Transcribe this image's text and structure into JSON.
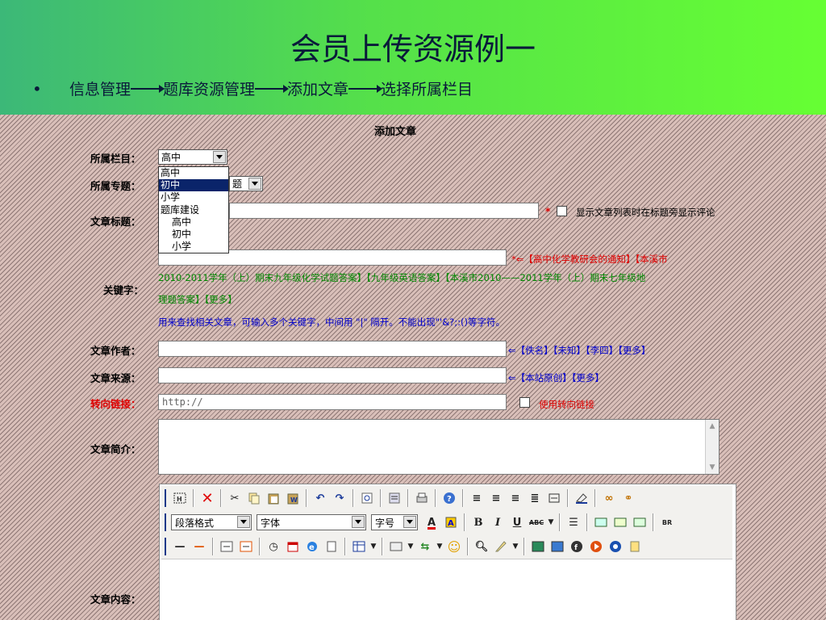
{
  "slide": {
    "title": "会员上传资源例一",
    "bullet": "•",
    "breadcrumb": [
      "信息管理",
      "题库资源管理",
      "添加文章",
      "选择所属栏目"
    ]
  },
  "form": {
    "title": "添加文章",
    "labels": {
      "column": "所属栏目：",
      "topic": "所属专题：",
      "article_title": "文章标题：",
      "keywords": "关键字：",
      "author": "文章作者：",
      "source": "文章来源：",
      "redirect": "转向链接：",
      "summary": "文章简介：",
      "content": "文章内容："
    },
    "column_select": {
      "value": "高中"
    },
    "column_options": [
      {
        "label": "高中",
        "selected": false,
        "indent": false
      },
      {
        "label": "初中",
        "selected": true,
        "indent": false
      },
      {
        "label": "小学",
        "selected": false,
        "indent": false
      },
      {
        "label": "题库建设",
        "selected": false,
        "indent": false
      },
      {
        "label": "高中",
        "selected": false,
        "indent": true
      },
      {
        "label": "初中",
        "selected": false,
        "indent": true
      },
      {
        "label": "小学",
        "selected": false,
        "indent": true
      }
    ],
    "topic_select": {
      "value": "题"
    },
    "title_required": "*",
    "show_comment_label": "显示文章列表时在标题旁显示评论",
    "keywords_line1": "*⇐【高中化学教研会的通知】【本溪市",
    "keywords_line2": "2010-2011学年（上）期末九年级化学试题答案】【九年级英语答案】【本溪市2010——2011学年（上）期末七年级地",
    "keywords_line3": "理题答案】【更多】",
    "keywords_hint": "用来查找相关文章，可输入多个关键字，中间用 \"|\" 隔开。不能出现\"'&?;:()等字符。",
    "author_links": "⇐【佚名】【未知】【李四】【更多】",
    "source_links": "⇐【本站原创】【更多】",
    "redirect_placeholder": "http://",
    "redirect_checkbox_label": "使用转向链接"
  },
  "editor": {
    "toolbar1_icons": [
      "source-icon",
      "delete-icon",
      "cut-icon",
      "copy-icon",
      "paste-icon",
      "paste-word-icon",
      "undo-icon",
      "redo-icon",
      "find-icon",
      "select-all-icon",
      "print-icon",
      "help-icon",
      "align-left-icon",
      "align-center-icon",
      "align-right-icon",
      "justify-icon",
      "insert-box-icon",
      "clear-format-icon",
      "link-icon",
      "unlink-icon"
    ],
    "paragraph_select": "段落格式",
    "font_select": "字体",
    "size_select": "字号",
    "bold_label": "B",
    "italic_label": "I",
    "underline_label": "U",
    "strike_label": "ABC",
    "font_color_label": "A",
    "br_label": "BR"
  }
}
